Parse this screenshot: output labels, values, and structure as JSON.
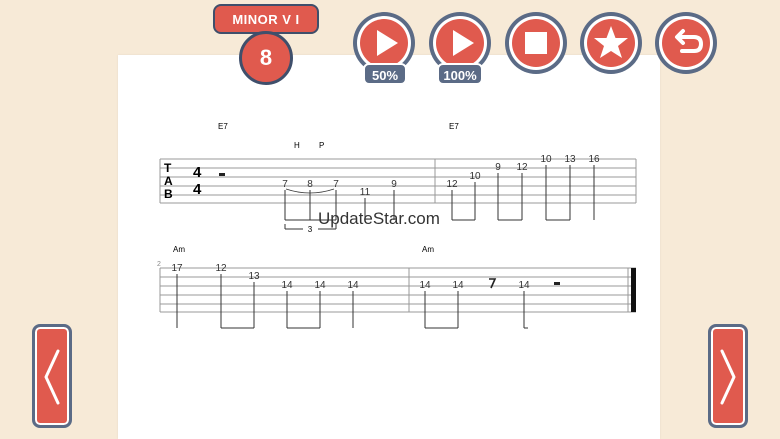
{
  "lesson": {
    "title": "MINOR V I",
    "number": "8"
  },
  "toolbar": {
    "speed_slow_label": "50%",
    "speed_normal_label": "100%",
    "accent_color": "#e05a4e",
    "frame_color": "#5b6b86"
  },
  "icons": [
    "play-icon",
    "stop-icon",
    "star-icon",
    "undo-icon",
    "chevron-left-icon",
    "chevron-right-icon"
  ],
  "watermark": "UpdateStar.com",
  "tab": {
    "clef_letters": [
      "T",
      "A",
      "B"
    ],
    "time_signature": [
      "4",
      "4"
    ],
    "system1": {
      "chords": [
        "E7",
        "E7"
      ],
      "techniques": [
        "H",
        "P"
      ],
      "tuplet": "3",
      "notes": [
        "7",
        "8",
        "7",
        "11",
        "9",
        "12",
        "10",
        "9",
        "12",
        "10",
        "13",
        "16"
      ]
    },
    "system2": {
      "measure_number": "2",
      "chords": [
        "Am",
        "Am"
      ],
      "notes": [
        "17",
        "12",
        "13",
        "14",
        "14",
        "14",
        "14",
        "14",
        "14"
      ]
    }
  }
}
